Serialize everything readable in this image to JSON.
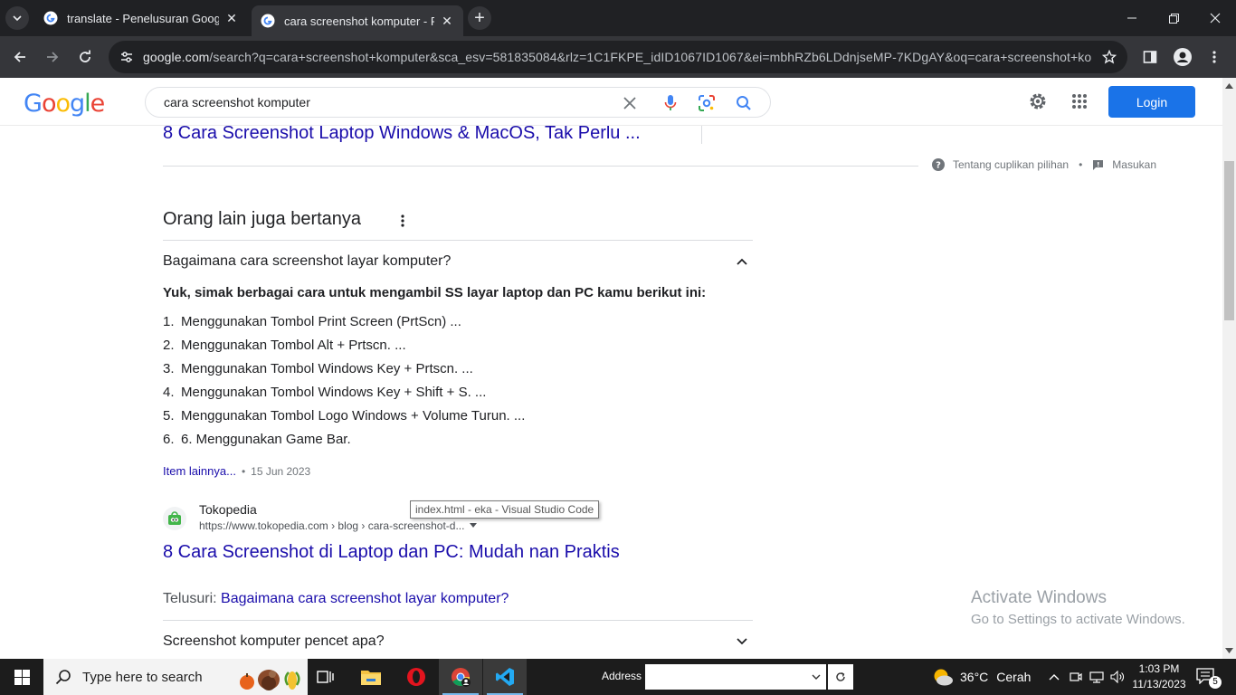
{
  "browser": {
    "tabs": [
      {
        "title": "translate - Penelusuran Google",
        "active": false
      },
      {
        "title": "cara screenshot komputer - Pen",
        "active": true
      }
    ],
    "url_host": "google.com",
    "url_path": "/search?q=cara+screenshot+komputer&sca_esv=581835084&rlz=1C1FKPE_idID1067ID1067&ei=mbhRZb6LDdnjseMP-7KDgAY&oq=cara+screenshot+kom..."
  },
  "google": {
    "logo_letters": [
      "G",
      "o",
      "o",
      "g",
      "l",
      "e"
    ],
    "logo_colors": [
      "#4285f4",
      "#ea4335",
      "#fbbc05",
      "#4285f4",
      "#34a853",
      "#ea4335"
    ],
    "query": "cara screenshot komputer",
    "login_label": "Login"
  },
  "results": {
    "prev_link": "8 Cara Screenshot Laptop Windows & MacOS, Tak Perlu ...",
    "about_snippet": "Tentang cuplikan pilihan",
    "bullet": "•",
    "feedback": "Masukan",
    "paa_title": "Orang lain juga bertanya",
    "question_1": "Bagaimana cara screenshot layar komputer?",
    "answer_heading": "Yuk, simak berbagai cara untuk mengambil SS layar laptop dan PC kamu berikut ini:",
    "answer_items": [
      {
        "num": "1.",
        "text": "Menggunakan Tombol Print Screen (PrtScn) ..."
      },
      {
        "num": "2.",
        "text": "Menggunakan Tombol Alt + Prtscn. ..."
      },
      {
        "num": "3.",
        "text": "Menggunakan Tombol Windows Key + Prtscn. ..."
      },
      {
        "num": "4.",
        "text": "Menggunakan Tombol Windows Key + Shift + S. ..."
      },
      {
        "num": "5.",
        "text": "Menggunakan Tombol Logo Windows + Volume Turun. ..."
      },
      {
        "num": "6.",
        "text": "6. Menggunakan Game Bar."
      }
    ],
    "more_items": "Item lainnya...",
    "answer_date": "15 Jun 2023",
    "source_name": "Tokopedia",
    "source_url": "https://www.tokopedia.com › blog › cara-screenshot-d...",
    "source_title": "8 Cara Screenshot di Laptop dan PC: Mudah nan Praktis",
    "explore_label": "Telusuri:",
    "explore_link": "Bagaimana cara screenshot layar komputer?",
    "question_2": "Screenshot komputer pencet apa?"
  },
  "tooltip": "index.html - eka - Visual Studio Code",
  "watermark": {
    "line1": "Activate Windows",
    "line2": "Go to Settings to activate Windows."
  },
  "taskbar": {
    "search_placeholder": "Type here to search",
    "address_label": "Address",
    "weather": "36°C",
    "weather_desc": "Cerah",
    "time": "1:03 PM",
    "date": "11/13/2023",
    "notif_count": "5"
  }
}
